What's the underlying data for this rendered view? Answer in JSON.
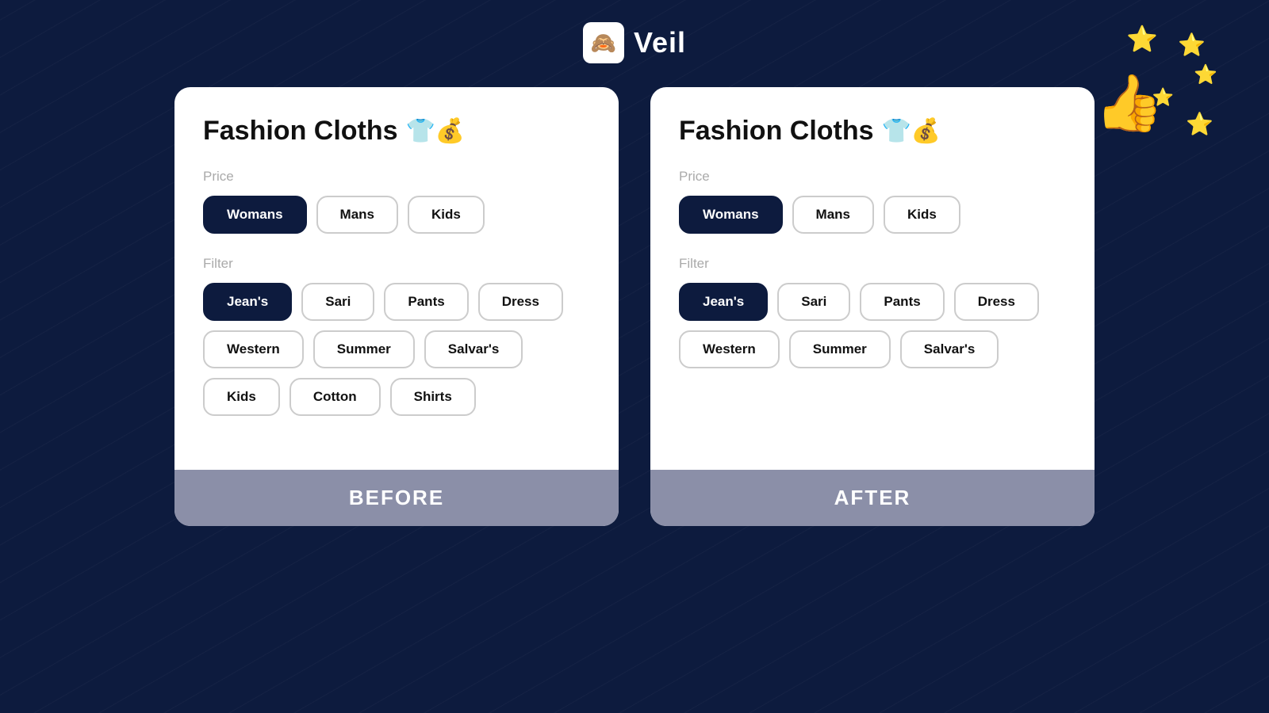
{
  "header": {
    "logo_icon": "🙈",
    "logo_text": "Veil"
  },
  "decoration": {
    "thumb": "👍",
    "stars": [
      "⭐",
      "⭐",
      "⭐",
      "⭐",
      "⭐"
    ]
  },
  "cards": [
    {
      "id": "before",
      "title": "Fashion Cloths",
      "title_emoji": "👕",
      "price_label": "Price",
      "price_buttons": [
        {
          "label": "Womans",
          "active": true
        },
        {
          "label": "Mans",
          "active": false
        },
        {
          "label": "Kids",
          "active": false
        }
      ],
      "filter_label": "Filter",
      "filter_buttons": [
        {
          "label": "Jean's",
          "active": true
        },
        {
          "label": "Sari",
          "active": false
        },
        {
          "label": "Pants",
          "active": false
        },
        {
          "label": "Dress",
          "active": false
        },
        {
          "label": "Western",
          "active": false
        },
        {
          "label": "Summer",
          "active": false
        },
        {
          "label": "Salvar's",
          "active": false
        },
        {
          "label": "Kids",
          "active": false
        },
        {
          "label": "Cotton",
          "active": false
        },
        {
          "label": "Shirts",
          "active": false
        }
      ],
      "footer_label": "BEFORE"
    },
    {
      "id": "after",
      "title": "Fashion Cloths",
      "title_emoji": "👕",
      "price_label": "Price",
      "price_buttons": [
        {
          "label": "Womans",
          "active": true
        },
        {
          "label": "Mans",
          "active": false
        },
        {
          "label": "Kids",
          "active": false
        }
      ],
      "filter_label": "Filter",
      "filter_buttons": [
        {
          "label": "Jean's",
          "active": true
        },
        {
          "label": "Sari",
          "active": false
        },
        {
          "label": "Pants",
          "active": false
        },
        {
          "label": "Dress",
          "active": false
        },
        {
          "label": "Western",
          "active": false
        },
        {
          "label": "Summer",
          "active": false
        },
        {
          "label": "Salvar's",
          "active": false
        }
      ],
      "footer_label": "AFTER"
    }
  ]
}
